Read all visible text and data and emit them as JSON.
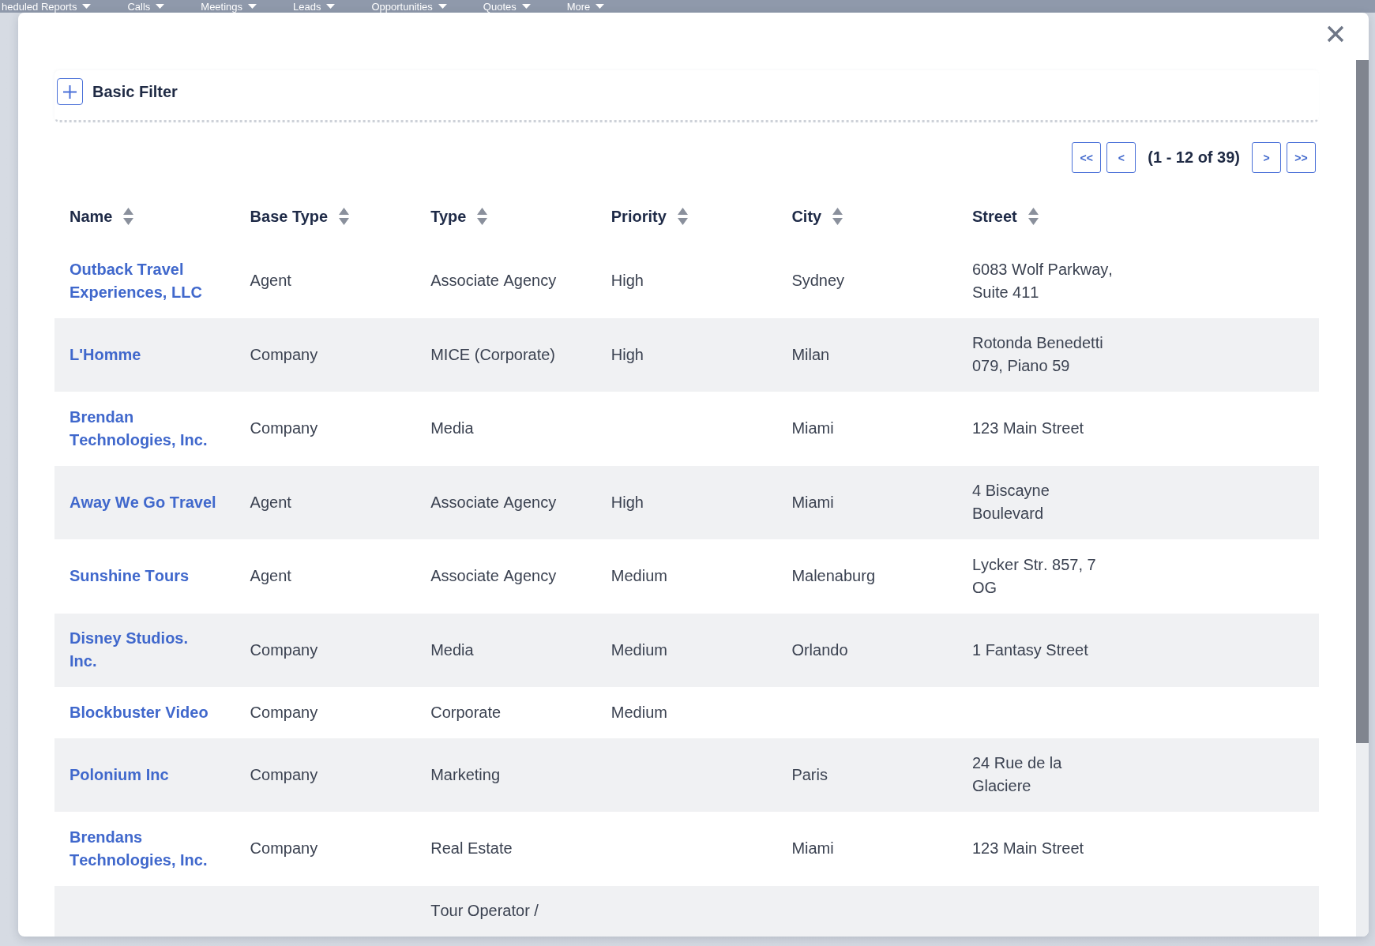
{
  "nav": {
    "items": [
      "heduled Reports",
      "Calls",
      "Meetings",
      "Leads",
      "Opportunities",
      "Quotes",
      "More"
    ]
  },
  "dialog": {
    "filter": {
      "title": "Basic Filter"
    },
    "pagination": {
      "first": "<<",
      "previous": "<",
      "range": "(1 - 12 of 39)",
      "next": ">",
      "last": ">>"
    },
    "table": {
      "columns": [
        "Name",
        "Base Type",
        "Type",
        "Priority",
        "City",
        "Street"
      ],
      "rows": [
        {
          "name": "Outback Travel Experiences, LLC",
          "base_type": "Agent",
          "type": "Associate Agency",
          "priority": "High",
          "city": "Sydney",
          "street": "6083 Wolf Parkway, Suite 411"
        },
        {
          "name": "L'Homme",
          "base_type": "Company",
          "type": "MICE (Corporate)",
          "priority": "High",
          "city": "Milan",
          "street": "Rotonda Benedetti 079, Piano 59"
        },
        {
          "name": "Brendan Technologies, Inc.",
          "base_type": "Company",
          "type": "Media",
          "city": "Miami",
          "street": "123 Main Street"
        },
        {
          "name": "Away We Go Travel",
          "base_type": "Agent",
          "type": "Associate Agency",
          "priority": "High",
          "city": "Miami",
          "street": "4 Biscayne Boulevard"
        },
        {
          "name": "Sunshine Tours",
          "base_type": "Agent",
          "type": "Associate Agency",
          "priority": "Medium",
          "city": "Malenaburg",
          "street": "Lycker Str. 857, 7 OG"
        },
        {
          "name": "Disney Studios. Inc.",
          "base_type": "Company",
          "type": "Media",
          "priority": "Medium",
          "city": "Orlando",
          "street": "1 Fantasy Street"
        },
        {
          "name": "Blockbuster Video",
          "base_type": "Company",
          "type": "Corporate",
          "priority": "Medium"
        },
        {
          "name": "Polonium Inc",
          "base_type": "Company",
          "type": "Marketing",
          "city": "Paris",
          "street": "24 Rue de la Glaciere"
        },
        {
          "name": "Brendans Technologies, Inc.",
          "base_type": "Company",
          "type": "Real Estate",
          "city": "Miami",
          "street": "123 Main Street"
        },
        {
          "type": "Tour Operator /"
        }
      ]
    }
  }
}
